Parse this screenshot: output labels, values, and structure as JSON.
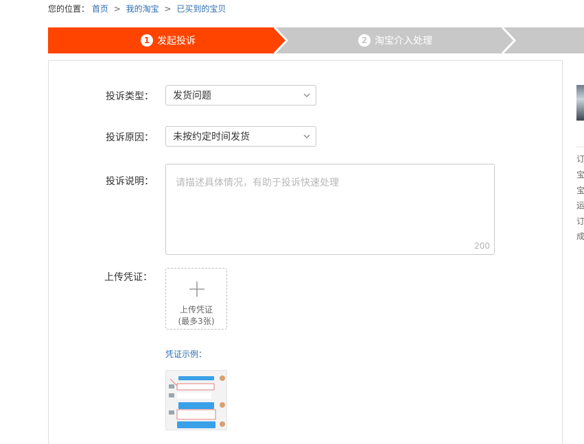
{
  "breadcrumb": {
    "prefix": "您的位置：",
    "items": [
      "首页",
      "我的淘宝",
      "已买到的宝贝"
    ],
    "separator": ">"
  },
  "steps": [
    {
      "number": "1",
      "label": "发起投诉",
      "active": true
    },
    {
      "number": "2",
      "label": "淘宝介入处理",
      "active": false
    }
  ],
  "colors": {
    "active_step": "#ff4400",
    "inactive_step": "#c8c8c8",
    "link": "#2b6cb0"
  },
  "form": {
    "type": {
      "label": "投诉类型：",
      "value": "发货问题"
    },
    "reason": {
      "label": "投诉原因：",
      "value": "未按约定时间发货"
    },
    "description": {
      "label": "投诉说明：",
      "placeholder": "请描述具体情况，有助于投诉快速处理",
      "counter": "200"
    },
    "upload": {
      "label": "上传凭证：",
      "line1": "上传凭证",
      "line2": "(最多3张)",
      "icon": "plus-icon"
    },
    "example_label": "凭证示例："
  },
  "sidebar": {
    "visible_chars": [
      "订",
      "宝",
      "宝",
      "运",
      "订",
      "成"
    ]
  }
}
